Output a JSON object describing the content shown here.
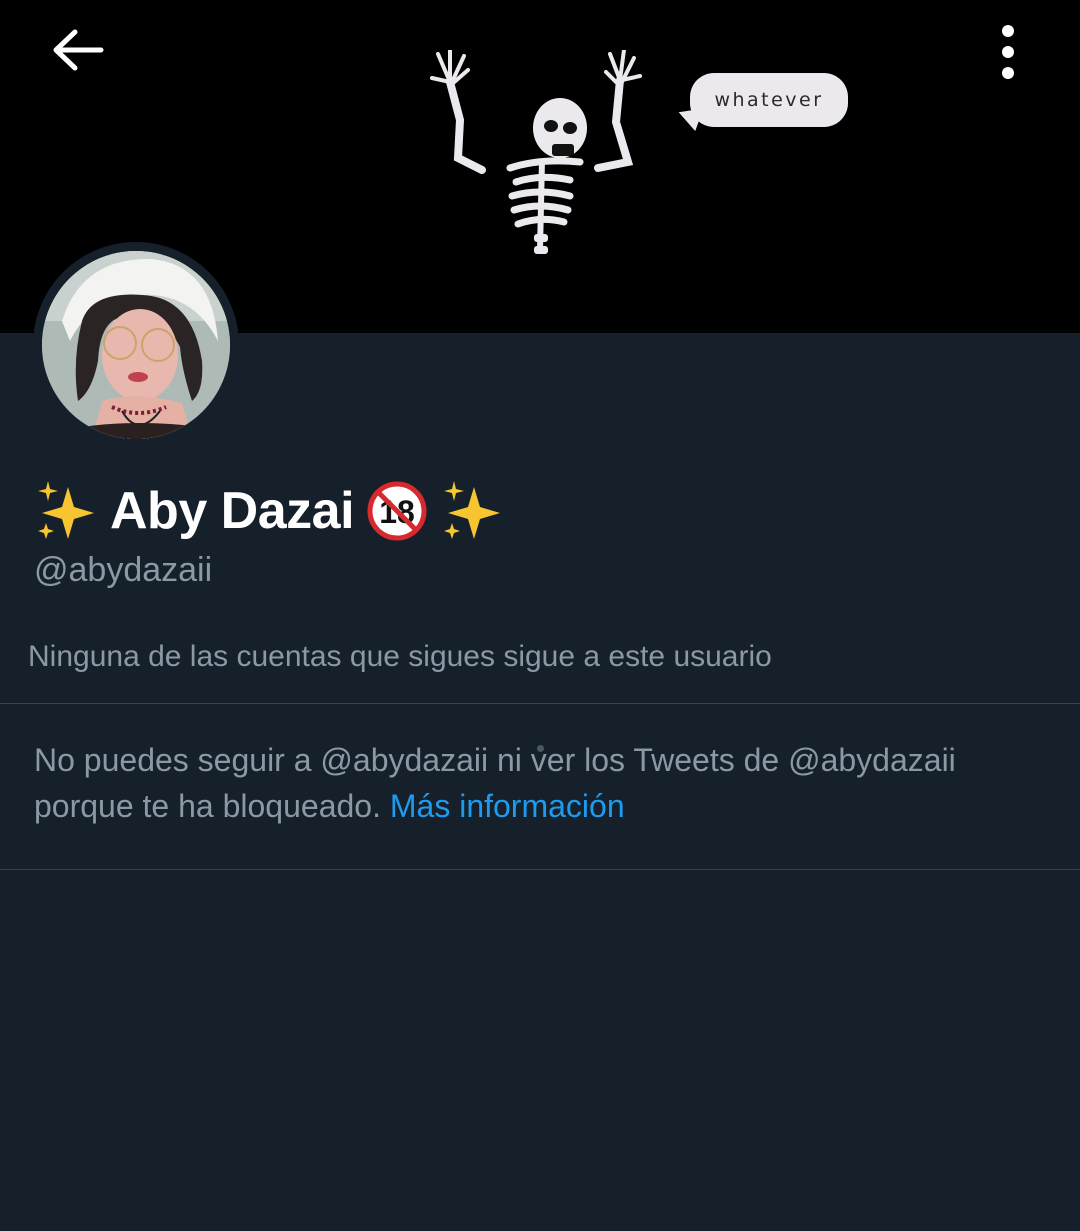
{
  "header": {
    "back_icon": "arrow-left-icon",
    "more_icon": "more-vertical-icon",
    "banner": {
      "speech_text": "whatever"
    }
  },
  "profile": {
    "display_name": "Aby Dazai",
    "name_emojis": {
      "leading": "✨",
      "badge": "18",
      "trailing": "✨"
    },
    "handle": "@abydazaii",
    "followers_you_know": "Ninguna de las cuentas que sigues sigue a este usuario"
  },
  "blocked_notice": {
    "text": "No puedes seguir a @abydazaii ni ver los Tweets de @abydazaii porque te ha bloqueado.",
    "link_label": "Más información"
  },
  "colors": {
    "background": "#16202a",
    "banner": "#000000",
    "secondary_text": "#8b98a5",
    "link": "#1d9bf0",
    "divider": "#38444d"
  }
}
